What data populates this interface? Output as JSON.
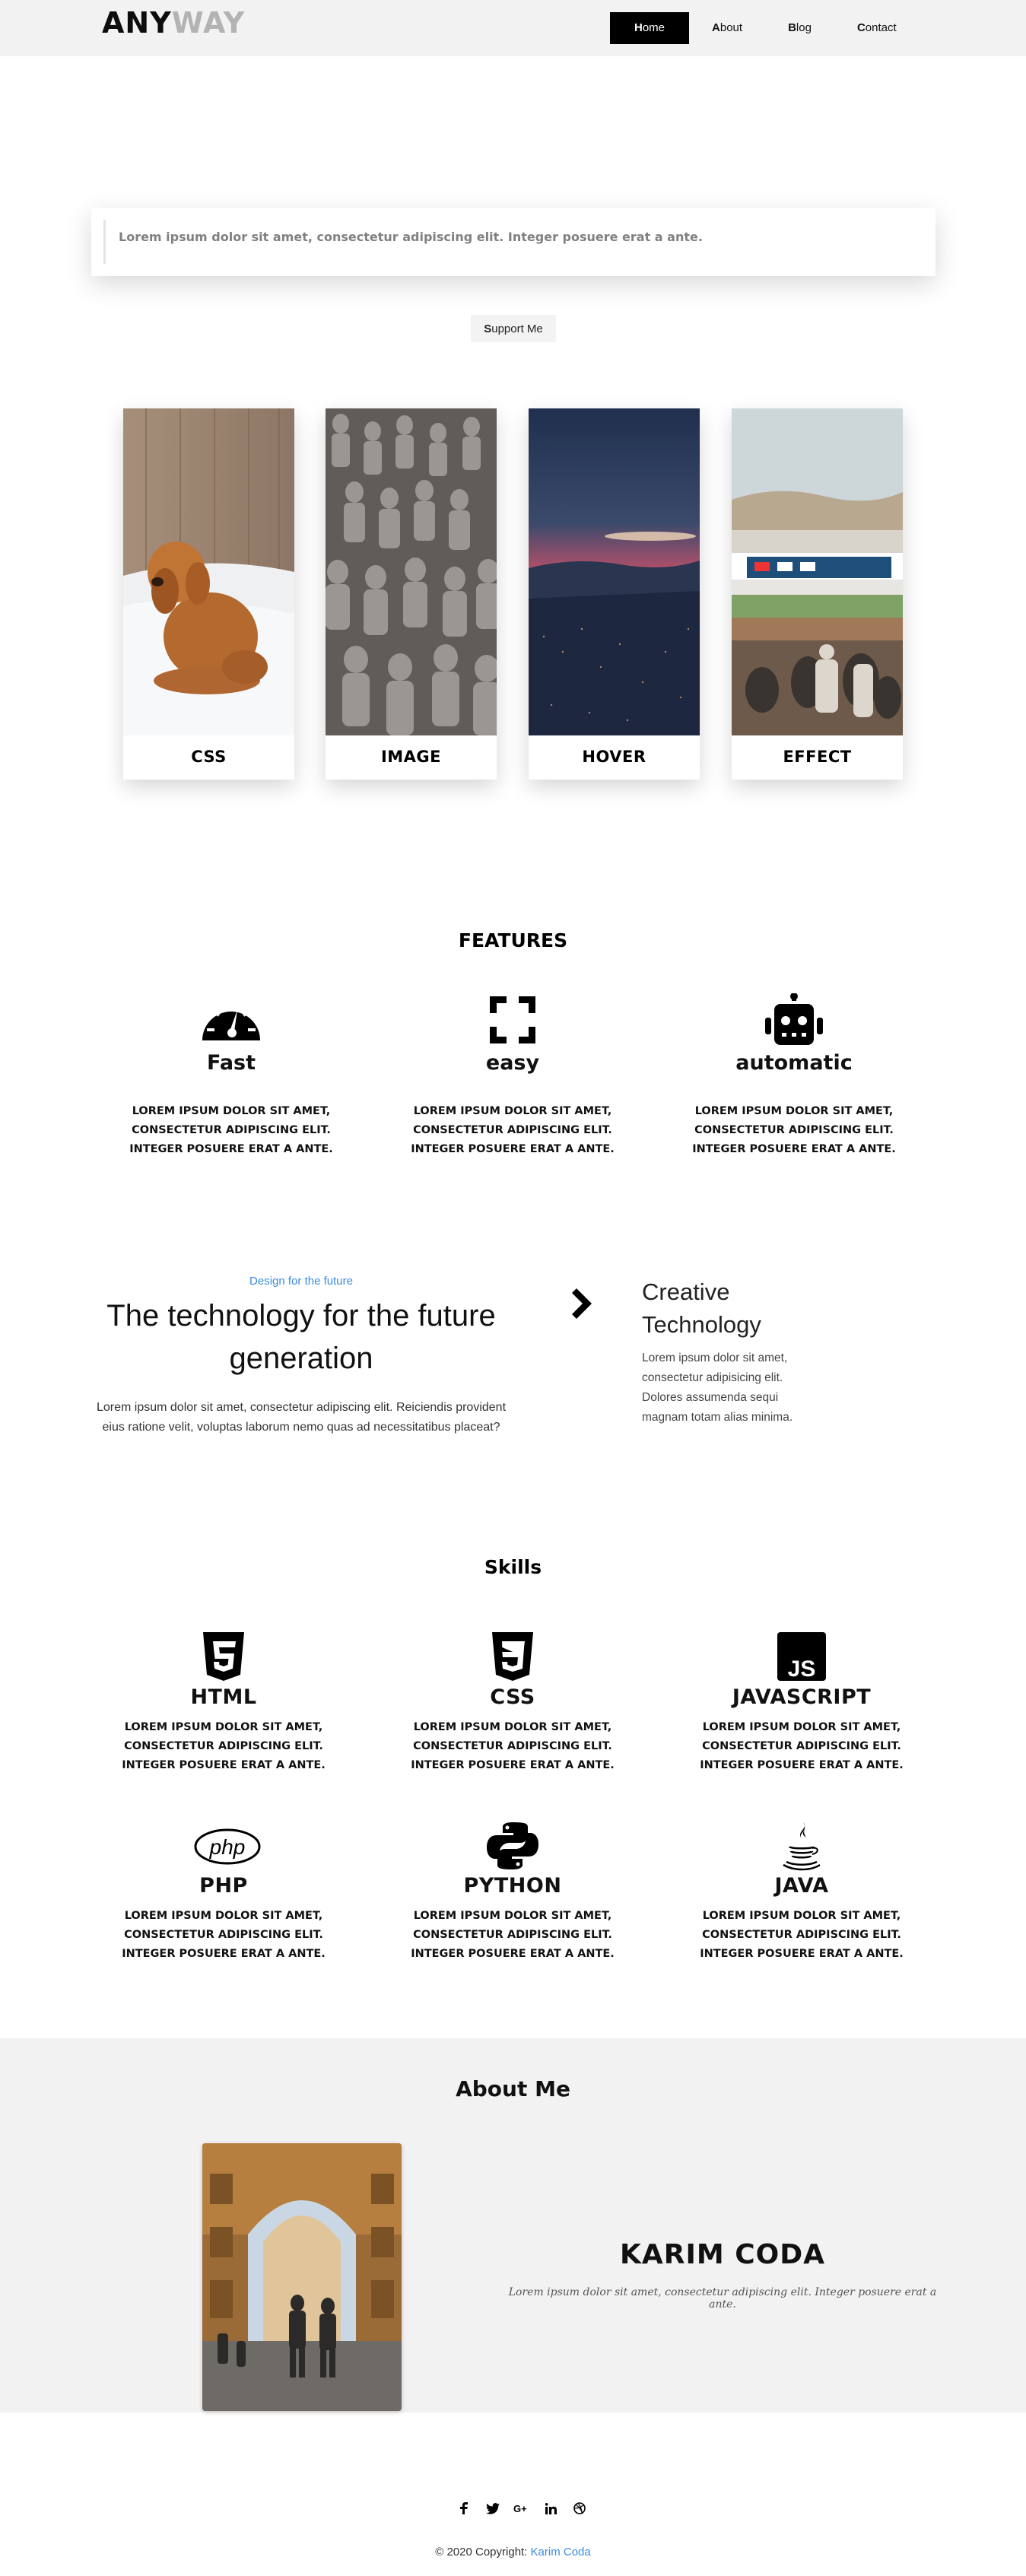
{
  "nav": {
    "logo_part1": "ANY",
    "logo_part2": "WAY",
    "items": [
      {
        "label": "Home",
        "active": true
      },
      {
        "label": "About"
      },
      {
        "label": "Blog"
      },
      {
        "label": "Contact"
      }
    ]
  },
  "hero": {
    "quote": "Lorem ipsum dolor sit amet, consectetur adipiscing elit. Integer posuere erat a ante.",
    "support_button": "Support Me"
  },
  "cards": [
    {
      "caption": "CSS",
      "image": "dog-in-snow"
    },
    {
      "caption": "IMAGE",
      "image": "terracotta-warriors"
    },
    {
      "caption": "HOVER",
      "image": "city-at-dusk"
    },
    {
      "caption": "EFFECT",
      "image": "racetrack-crowd"
    }
  ],
  "features": {
    "title": "FEATURES",
    "items": [
      {
        "icon": "speedometer-icon",
        "title": "Fast",
        "text": "LOREM IPSUM DOLOR SIT AMET, CONSECTETUR ADIPISCING ELIT. INTEGER POSUERE ERAT A ANTE."
      },
      {
        "icon": "expand-icon",
        "title": "easy",
        "text": "LOREM IPSUM DOLOR SIT AMET, CONSECTETUR ADIPISCING ELIT. INTEGER POSUERE ERAT A ANTE."
      },
      {
        "icon": "robot-icon",
        "title": "automatic",
        "text": "LOREM IPSUM DOLOR SIT AMET, CONSECTETUR ADIPISCING ELIT. INTEGER POSUERE ERAT A ANTE."
      }
    ]
  },
  "tech": {
    "kicker": "Design for the future",
    "title": "The technology for the future generation",
    "description": "Lorem ipsum dolor sit amet, consectetur adipiscing elit. Reiciendis provident eius ratione velit, voluptas laborum nemo quas ad necessitatibus placeat?",
    "side_title": "Creative Technology",
    "side_text": "Lorem ipsum dolor sit amet, consectetur adipisicing elit. Dolores assumenda sequi magnam totam alias minima."
  },
  "skills": {
    "title": "Skills",
    "items": [
      {
        "icon": "html5-icon",
        "title": "HTML",
        "text": "LOREM IPSUM DOLOR SIT AMET, CONSECTETUR ADIPISCING ELIT. INTEGER POSUERE ERAT A ANTE."
      },
      {
        "icon": "css3-icon",
        "title": "CSS",
        "text": "LOREM IPSUM DOLOR SIT AMET, CONSECTETUR ADIPISCING ELIT. INTEGER POSUERE ERAT A ANTE."
      },
      {
        "icon": "javascript-icon",
        "title": "JAVASCRIPT",
        "text": "LOREM IPSUM DOLOR SIT AMET, CONSECTETUR ADIPISCING ELIT. INTEGER POSUERE ERAT A ANTE."
      },
      {
        "icon": "php-icon",
        "title": "PHP",
        "text": "LOREM IPSUM DOLOR SIT AMET, CONSECTETUR ADIPISCING ELIT. INTEGER POSUERE ERAT A ANTE."
      },
      {
        "icon": "python-icon",
        "title": "PYTHON",
        "text": "LOREM IPSUM DOLOR SIT AMET, CONSECTETUR ADIPISCING ELIT. INTEGER POSUERE ERAT A ANTE."
      },
      {
        "icon": "java-icon",
        "title": "JAVA",
        "text": "LOREM IPSUM DOLOR SIT AMET, CONSECTETUR ADIPISCING ELIT. INTEGER POSUERE ERAT A ANTE."
      }
    ]
  },
  "about": {
    "title": "About Me",
    "name": "KARIM CODA",
    "bio": "Lorem ipsum dolor sit amet, consectetur adipiscing elit. Integer posuere erat a ante."
  },
  "footer": {
    "social": [
      "facebook-icon",
      "twitter-icon",
      "google-plus-icon",
      "linkedin-icon",
      "dribbble-icon"
    ],
    "copyright": "© 2020 Copyright: ",
    "author": "Karim Coda"
  },
  "colors": {
    "nav_bg": "#f2f2f2",
    "accent_link": "#3a8de0",
    "logo_grey": "#b3b3b3"
  }
}
